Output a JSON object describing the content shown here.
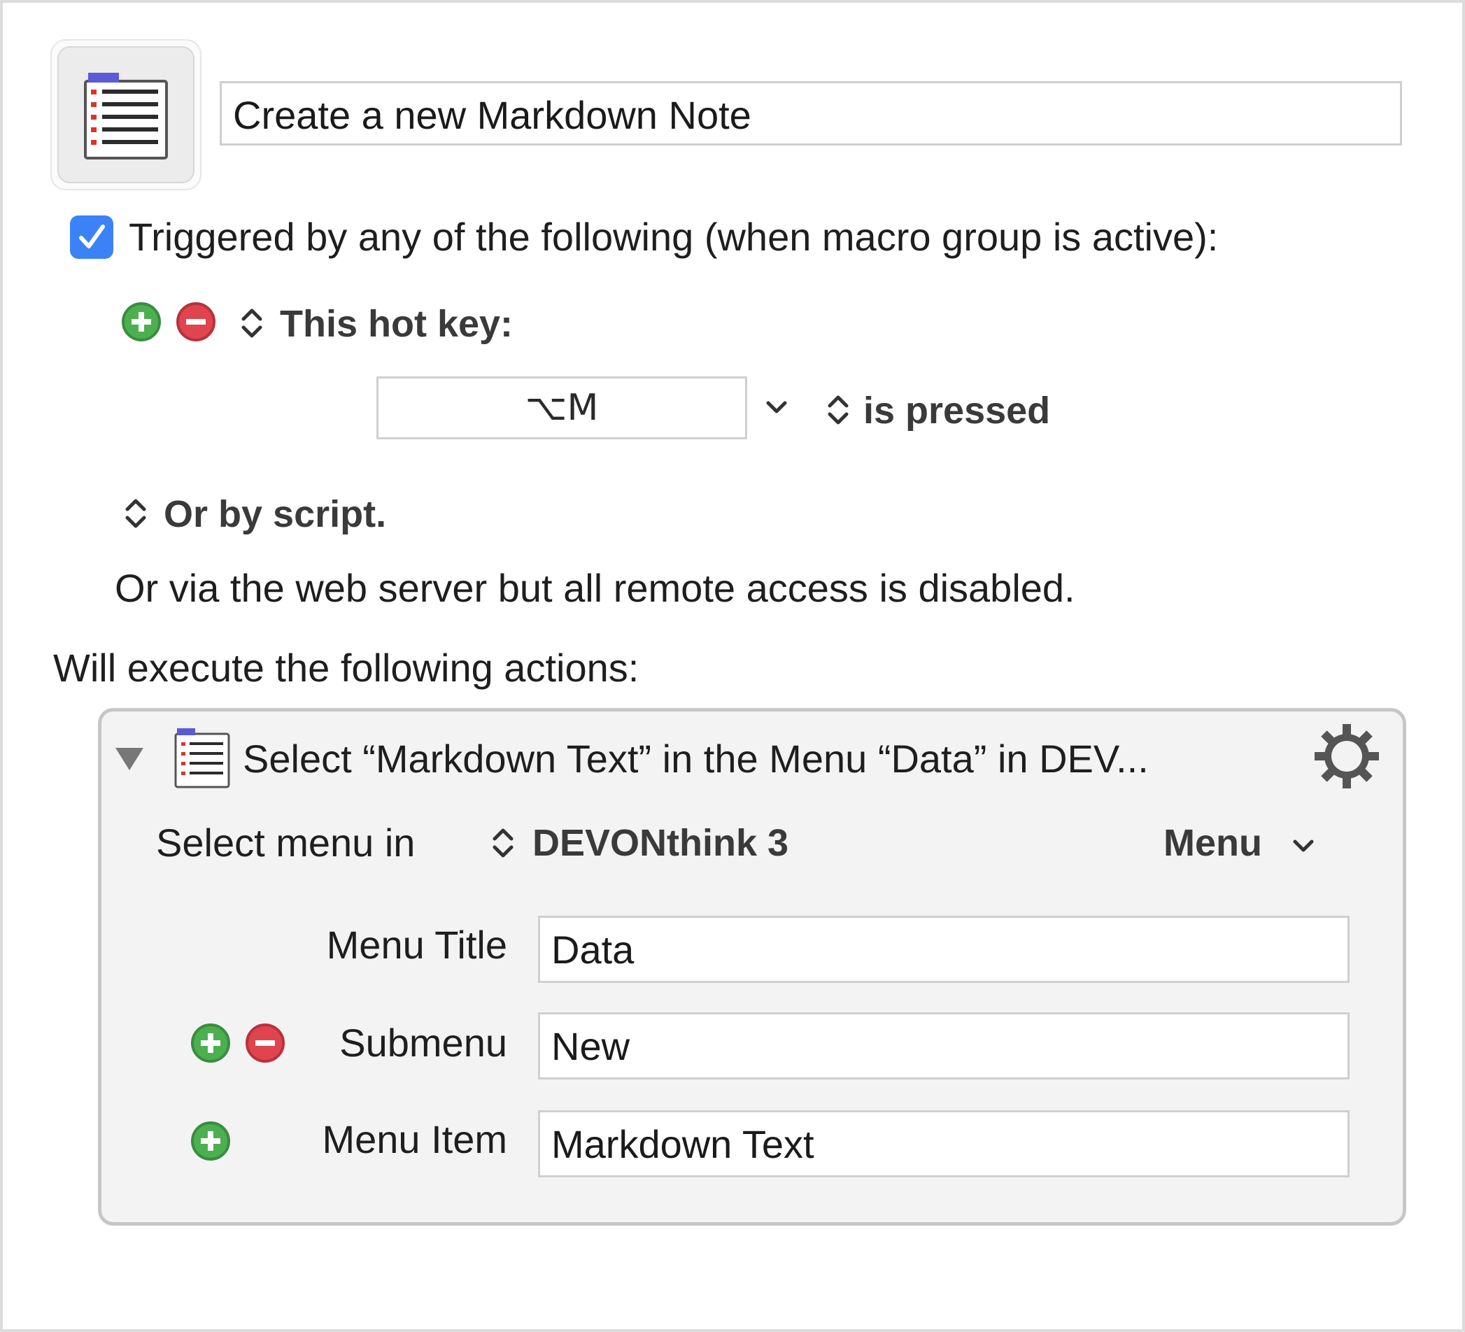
{
  "macro": {
    "name": "Create a new Markdown Note"
  },
  "trigger": {
    "enabled_label": "Triggered by any of the following (when macro group is active):",
    "type_label": "This hot key:",
    "hotkey": "⌥M",
    "condition": "is pressed",
    "script_label": "Or by script.",
    "web_server_text": "Or via the web server but all remote access is disabled."
  },
  "actions": {
    "heading": "Will execute the following actions:",
    "action_title": "Select “Markdown Text” in the Menu “Data” in DEV...",
    "select_menu_label": "Select menu in",
    "app_name": "DEVONthink 3",
    "menu_dropdown": "Menu",
    "fields": {
      "menu_title_label": "Menu Title",
      "menu_title_value": "Data",
      "submenu_label": "Submenu",
      "submenu_value": "New",
      "menu_item_label": "Menu Item",
      "menu_item_value": "Markdown Text"
    }
  },
  "colors": {
    "accent": "#3b82f6",
    "add_green": "#4caf50",
    "remove_red": "#e0444e"
  }
}
